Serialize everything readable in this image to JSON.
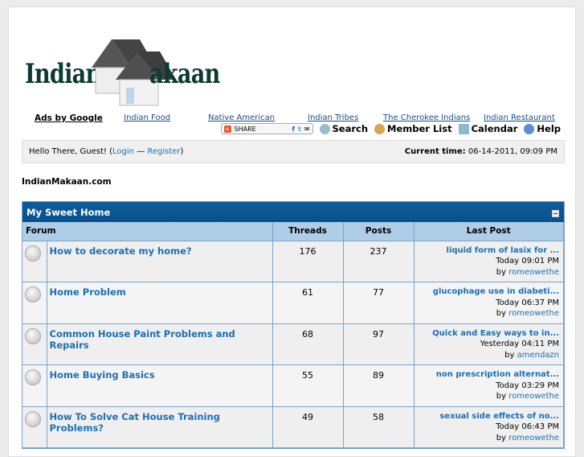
{
  "logo": {
    "left": "Indian",
    "right": "akaan"
  },
  "ads": {
    "title": "Ads by Google",
    "links": [
      "Indian Food",
      "Native American",
      "Indian Tribes",
      "The Cherokee Indians",
      "Indian Restaurant"
    ]
  },
  "toolbar": {
    "share": "SHARE",
    "search": "Search",
    "members": "Member List",
    "calendar": "Calendar",
    "help": "Help"
  },
  "welcome": {
    "greeting": "Hello There, Guest! (",
    "login": "Login",
    "sep": " — ",
    "register": "Register",
    "close": ")",
    "time_label": "Current time:",
    "time": " 06-14-2011, 09:09 PM"
  },
  "site_name": "IndianMakaan.com",
  "category": {
    "title": "My Sweet Home",
    "columns": [
      "Forum",
      "Threads",
      "Posts",
      "Last Post"
    ],
    "forums": [
      {
        "name": "How to decorate my home?",
        "threads": "176",
        "posts": "237",
        "last_title": "liquid form of lasix for ...",
        "last_time": "Today 09:01 PM",
        "by": "by ",
        "user": "romeowethe"
      },
      {
        "name": "Home Problem",
        "threads": "61",
        "posts": "77",
        "last_title": "glucophage use in diabeti...",
        "last_time": "Today 06:37 PM",
        "by": "by ",
        "user": "romeowethe"
      },
      {
        "name": "Common House Paint Problems and Repairs",
        "threads": "68",
        "posts": "97",
        "last_title": "Quick and Easy ways to in...",
        "last_time": "Yesterday 04:11 PM",
        "by": "by ",
        "user": "amendazn"
      },
      {
        "name": "Home Buying Basics",
        "threads": "55",
        "posts": "89",
        "last_title": "non prescription alternat...",
        "last_time": "Today 03:29 PM",
        "by": "by ",
        "user": "romeowethe"
      },
      {
        "name": "How To Solve Cat House Training Problems?",
        "threads": "49",
        "posts": "58",
        "last_title": "sexual side effects of no...",
        "last_time": "Today 06:43 PM",
        "by": "by ",
        "user": "romeowethe"
      }
    ]
  }
}
